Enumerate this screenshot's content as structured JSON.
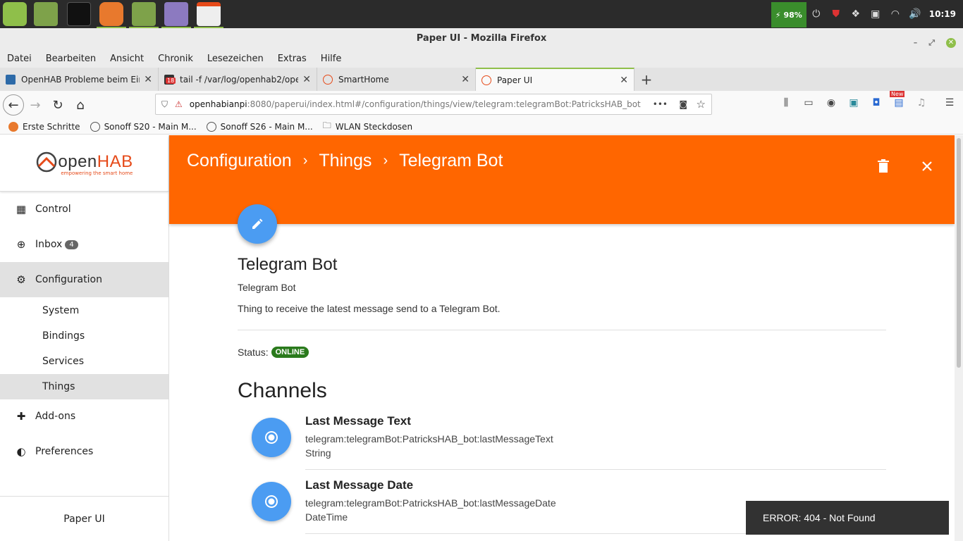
{
  "taskbar": {
    "battery_percent": "98%",
    "clock": "10:19"
  },
  "window": {
    "title": "Paper UI - Mozilla Firefox"
  },
  "menubar": {
    "items": [
      "Datei",
      "Bearbeiten",
      "Ansicht",
      "Chronik",
      "Lesezeichen",
      "Extras",
      "Hilfe"
    ]
  },
  "tabs": [
    {
      "title": "OpenHAB Probleme beim Ein"
    },
    {
      "title": "tail -f /var/log/openhab2/ope",
      "badge": "18"
    },
    {
      "title": "SmartHome"
    },
    {
      "title": "Paper UI"
    }
  ],
  "urlbar": {
    "host": "openhabianpi",
    "rest": ":8080/paperui/index.html#/configuration/things/view/telegram:telegramBot:PatricksHAB_bot",
    "more": "•••"
  },
  "nav_badge_new": "New",
  "bookmarks": [
    "Erste Schritte",
    "Sonoff S20 - Main M...",
    "Sonoff S26 - Main M...",
    "WLAN Steckdosen"
  ],
  "sidebar": {
    "logo_main": "open",
    "logo_accent": "HAB",
    "logo_sub": "empowering the smart home",
    "items": [
      {
        "label": "Control"
      },
      {
        "label": "Inbox",
        "badge": "4"
      },
      {
        "label": "Configuration"
      },
      {
        "label": "Add-ons"
      },
      {
        "label": "Preferences"
      }
    ],
    "sub_items": [
      "System",
      "Bindings",
      "Services",
      "Things"
    ],
    "footer": "Paper UI"
  },
  "header": {
    "crumbs": [
      "Configuration",
      "Things",
      "Telegram Bot"
    ],
    "sep": "›"
  },
  "thing": {
    "title": "Telegram Bot",
    "label": "Telegram Bot",
    "description": "Thing to receive the latest message send to a Telegram Bot.",
    "status_label": "Status:",
    "status": "ONLINE"
  },
  "channels": {
    "heading": "Channels",
    "items": [
      {
        "title": "Last Message Text",
        "uid": "telegram:telegramBot:PatricksHAB_bot:lastMessageText",
        "type": "String"
      },
      {
        "title": "Last Message Date",
        "uid": "telegram:telegramBot:PatricksHAB_bot:lastMessageDate",
        "type": "DateTime"
      }
    ]
  },
  "toast": {
    "message": "ERROR: 404 - Not Found"
  },
  "colors": {
    "accent": "#ff6600",
    "fab": "#4b9cf2",
    "online": "#2a7a1c"
  }
}
